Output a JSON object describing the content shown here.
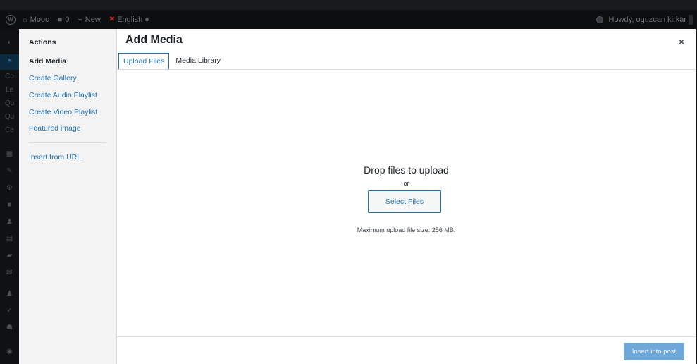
{
  "admin_bar": {
    "site_name": "Mooc",
    "comments_count": "0",
    "new_label": "New",
    "language_label": "English",
    "howdy_label": "Howdy, oguzcan kirkar"
  },
  "admin_menu": {
    "partial_labels": [
      "Co",
      "Le",
      "Qu",
      "Qu",
      "Ce"
    ]
  },
  "media_modal": {
    "menu": {
      "title": "Actions",
      "items": [
        {
          "label": "Add Media",
          "current": true
        },
        {
          "label": "Create Gallery"
        },
        {
          "label": "Create Audio Playlist"
        },
        {
          "label": "Create Video Playlist"
        },
        {
          "label": "Featured image"
        }
      ],
      "insert_url_label": "Insert from URL"
    },
    "title": "Add Media",
    "close_symbol": "×",
    "tabs": [
      {
        "label": "Upload Files",
        "active": true
      },
      {
        "label": "Media Library"
      }
    ],
    "uploader": {
      "drop_text": "Drop files to upload",
      "or_text": "or",
      "select_button": "Select Files",
      "max_size_text": "Maximum upload file size: 256 MB."
    },
    "toolbar": {
      "insert_button": "Insert into post"
    }
  },
  "colors": {
    "accent": "#2271b1",
    "insert_button_disabled": "#6fa8d8",
    "admin_bar_bg": "#0d0e0f"
  }
}
